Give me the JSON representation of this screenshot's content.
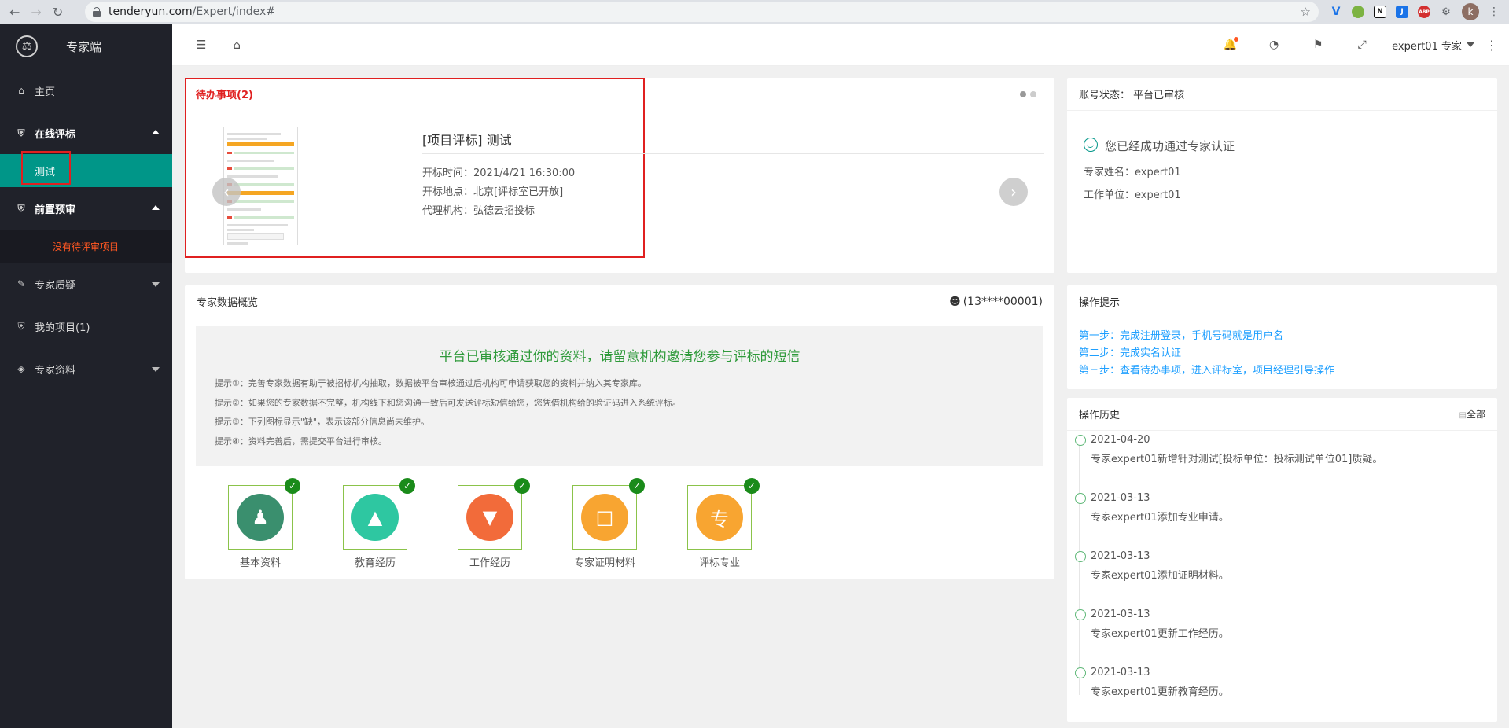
{
  "browser": {
    "url_host": "tenderyun.com",
    "url_path": "/Expert/index#",
    "ext_letters": [
      "V",
      "",
      "N",
      "J",
      "ABP",
      "",
      "k"
    ]
  },
  "sidebar": {
    "app_name": "专家端",
    "items": [
      {
        "label": "主页"
      },
      {
        "label": "在线评标"
      },
      {
        "label": "测试"
      },
      {
        "label": "前置预审"
      },
      {
        "label": "没有待评审项目"
      },
      {
        "label": "专家质疑"
      },
      {
        "label": "我的项目(1)"
      },
      {
        "label": "专家资料"
      }
    ]
  },
  "topbar": {
    "user_label": "expert01 专家"
  },
  "todo": {
    "title": "待办事项(2)",
    "project_title": "[项目评标] 测试",
    "open_time": "开标时间：2021/4/21 16:30:00",
    "open_place": "开标地点：北京[评标室已开放]",
    "agency": "代理机构：弘德云招投标"
  },
  "account": {
    "status": "账号状态：   平台已审核",
    "ok_text": "您已经成功通过专家认证",
    "name": "专家姓名：expert01",
    "unit": "工作单位：expert01"
  },
  "overview": {
    "title": "专家数据概览",
    "phone": "(13****00001)",
    "banner_head": "平台已审核通过你的资料，请留意机构邀请您参与评标的短信",
    "tips": [
      "提示①：完善专家数据有助于被招标机构抽取，数据被平台审核通过后机构可申请获取您的资料并纳入其专家库。",
      "提示②：如果您的专家数据不完整，机构线下和您沟通一致后可发送评标短信给您，您凭借机构给的验证码进入系统评标。",
      "提示③：下列图标显示\"缺\"，表示该部分信息尚未维护。",
      "提示④：资料完善后，需提交平台进行审核。"
    ],
    "tiles": [
      {
        "label": "基本资料",
        "color": "#3a8f6e"
      },
      {
        "label": "教育经历",
        "color": "#2ec7a1"
      },
      {
        "label": "工作经历",
        "color": "#f26b3a"
      },
      {
        "label": "专家证明材料",
        "color": "#f8a531"
      },
      {
        "label": "评标专业",
        "color": "#f8a531",
        "glyph": "专"
      }
    ]
  },
  "op_tips": {
    "title": "操作提示",
    "steps": [
      "第一步：完成注册登录，手机号码就是用户名",
      "第二步：完成实名认证",
      "第三步：查看待办事项，进入评标室，项目经理引导操作"
    ]
  },
  "history": {
    "title": "操作历史",
    "all_label": "全部",
    "items": [
      {
        "date": "2021-04-20",
        "text": "专家expert01新增针对测试[投标单位：投标测试单位01]质疑。"
      },
      {
        "date": "2021-03-13",
        "text": "专家expert01添加专业申请。"
      },
      {
        "date": "2021-03-13",
        "text": "专家expert01添加证明材料。"
      },
      {
        "date": "2021-03-13",
        "text": "专家expert01更新工作经历。"
      },
      {
        "date": "2021-03-13",
        "text": "专家expert01更新教育经历。"
      }
    ]
  }
}
